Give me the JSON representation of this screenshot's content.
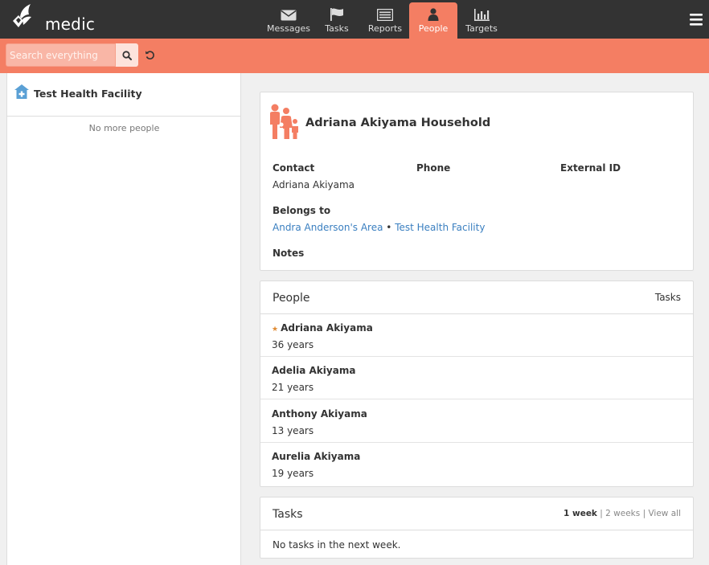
{
  "app": {
    "name": "medic"
  },
  "nav": {
    "tabs": [
      {
        "label": "Messages",
        "icon": "envelope-icon"
      },
      {
        "label": "Tasks",
        "icon": "flag-icon"
      },
      {
        "label": "Reports",
        "icon": "list-icon"
      },
      {
        "label": "People",
        "icon": "person-icon",
        "active": true
      },
      {
        "label": "Targets",
        "icon": "bar-chart-icon"
      }
    ]
  },
  "search": {
    "placeholder": "Search everything",
    "value": ""
  },
  "left": {
    "facility": "Test Health Facility",
    "no_more": "No more people"
  },
  "summary": {
    "title": "Adriana Akiyama Household",
    "contact_label": "Contact",
    "contact_value": "Adriana Akiyama",
    "phone_label": "Phone",
    "external_id_label": "External ID",
    "belongs_label": "Belongs to",
    "belongs_area": "Andra Anderson's Area",
    "belongs_sep": "•",
    "belongs_facility": "Test Health Facility",
    "notes_label": "Notes"
  },
  "people": {
    "title": "People",
    "right_label": "Tasks",
    "items": [
      {
        "name": "Adriana Akiyama",
        "age": "36 years",
        "primary": true
      },
      {
        "name": "Adelia Akiyama",
        "age": "21 years"
      },
      {
        "name": "Anthony Akiyama",
        "age": "13 years"
      },
      {
        "name": "Aurelia Akiyama",
        "age": "19 years"
      }
    ]
  },
  "tasks": {
    "title": "Tasks",
    "filter_1week": "1 week",
    "filter_sep1": "|",
    "filter_2weeks": "2 weeks",
    "filter_sep2": "|",
    "filter_all": "View all",
    "empty": "No tasks in the next week."
  },
  "colors": {
    "accent": "#f47e63",
    "header": "#333333",
    "link": "#3a7fc0",
    "star": "#e08b34"
  }
}
